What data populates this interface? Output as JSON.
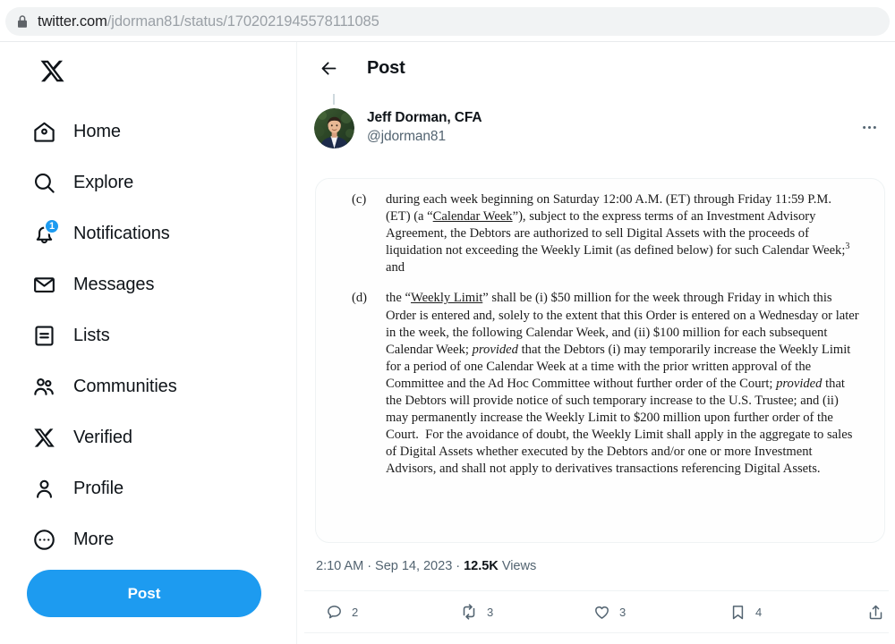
{
  "browser": {
    "lock_icon": "lock-icon",
    "url_host": "twitter.com",
    "url_path": "/jdorman81/status/1702021945578111085"
  },
  "colors": {
    "accent": "#1d9bf0",
    "text_primary": "#0f1419",
    "text_secondary": "#536471",
    "border": "#eff3f4",
    "chrome_pill": "#f1f3f4"
  },
  "sidebar": {
    "logo_icon": "x-logo-icon",
    "items": [
      {
        "label": "Home",
        "icon": "home-icon",
        "badge": ""
      },
      {
        "label": "Explore",
        "icon": "search-icon",
        "badge": ""
      },
      {
        "label": "Notifications",
        "icon": "bell-icon",
        "badge": "1"
      },
      {
        "label": "Messages",
        "icon": "envelope-icon",
        "badge": ""
      },
      {
        "label": "Lists",
        "icon": "list-icon",
        "badge": ""
      },
      {
        "label": "Communities",
        "icon": "people-icon",
        "badge": ""
      },
      {
        "label": "Verified",
        "icon": "x-badge-icon",
        "badge": ""
      },
      {
        "label": "Profile",
        "icon": "person-icon",
        "badge": ""
      },
      {
        "label": "More",
        "icon": "more-circle-icon",
        "badge": ""
      }
    ],
    "post_button_label": "Post"
  },
  "main": {
    "back_icon": "back-arrow-icon",
    "header_title": "Post",
    "more_icon": "more-horizontal-icon",
    "author": {
      "avatar": "avatar",
      "display_name": "Jeff Dorman, CFA",
      "handle": "@jdorman81"
    },
    "document": {
      "paragraphs": [
        {
          "marker": "(c)",
          "html": "during each week beginning on Saturday 12:00 A.M. (ET) through Friday 11:59 P.M. (ET) (a &ldquo;<u>Calendar Week</u>&rdquo;), subject to the express terms of an Investment Advisory Agreement, the Debtors are authorized to sell Digital Assets with the proceeds of liquidation not exceeding the Weekly Limit (as defined below) for such Calendar Week;<sup>3</sup> and"
        },
        {
          "marker": "(d)",
          "html": "the &ldquo;<u>Weekly Limit</u>&rdquo; shall be (i) $50 million for the week through Friday in which this Order is entered and, solely to the extent that this Order is entered on a Wednesday or later in the week, the following Calendar Week, and (ii) $100 million for each subsequent Calendar Week; <i>provided</i> that the Debtors (i) may temporarily increase the Weekly Limit for a period of one Calendar Week at a time with the prior written approval of the Committee and the Ad Hoc Committee without further order of the Court; <i>provided</i> that the Debtors will provide notice of such temporary increase to the U.S. Trustee; and (ii) may permanently increase the Weekly Limit to $200 million upon further order of the Court.&nbsp; For the avoidance of doubt, the Weekly Limit shall apply in the aggregate to sales of Digital Assets whether executed by the Debtors and/or one or more Investment Advisors, and shall not apply to derivatives transactions referencing Digital Assets."
        }
      ]
    },
    "meta": {
      "time": "2:10 AM",
      "separator": " · ",
      "date": "Sep 14, 2023",
      "views_count": "12.5K",
      "views_label": "Views"
    },
    "actions": [
      {
        "name": "reply",
        "icon": "reply-icon",
        "count": "2"
      },
      {
        "name": "repost",
        "icon": "retweet-icon",
        "count": "3"
      },
      {
        "name": "like",
        "icon": "heart-icon",
        "count": "3"
      },
      {
        "name": "bookmark",
        "icon": "bookmark-icon",
        "count": "4"
      },
      {
        "name": "share",
        "icon": "share-icon",
        "count": ""
      }
    ]
  }
}
